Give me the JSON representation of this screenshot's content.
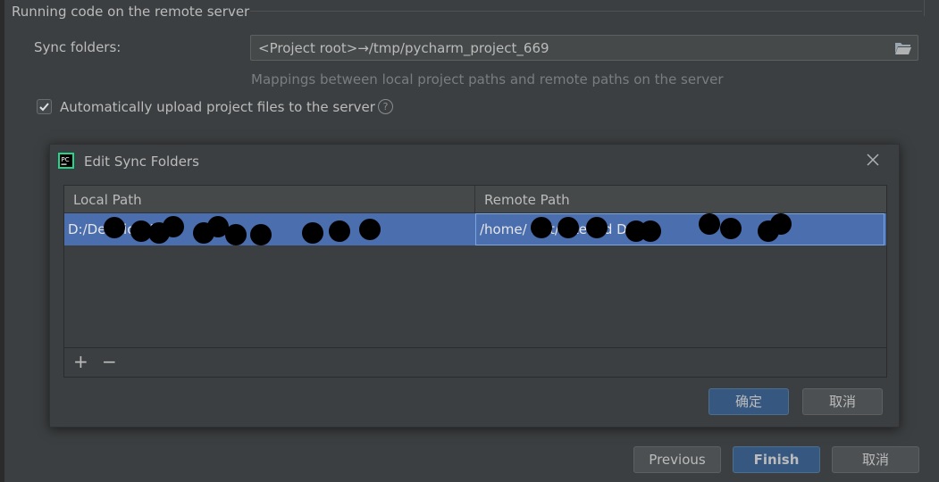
{
  "section": {
    "title": "Running code on the remote server"
  },
  "sync": {
    "label": "Sync folders:",
    "value": "<Project root>→/tmp/pycharm_project_669",
    "hint": "Mappings between local project paths and remote paths on the server",
    "folder_icon": "folder-open-icon"
  },
  "auto_upload": {
    "checked": true,
    "label": "Automatically upload project files to the server",
    "help_glyph": "?"
  },
  "dialog": {
    "title": "Edit Sync Folders",
    "app_icon_text": "PC",
    "columns": [
      "Local Path",
      "Remote Path"
    ],
    "rows": [
      {
        "local": "D:/De        i          tionV      P  ",
        "remote": "/home/      L_    t/Atte     Vid    DPose"
      }
    ],
    "add_glyph": "+",
    "remove_glyph": "−",
    "ok_label": "确定",
    "cancel_label": "取消"
  },
  "footer": {
    "previous_label": "Previous",
    "finish_label": "Finish",
    "cancel_label": "取消"
  },
  "colors": {
    "background": "#3c3f41",
    "selection": "#4b6eaf",
    "primary_button": "#365880"
  }
}
